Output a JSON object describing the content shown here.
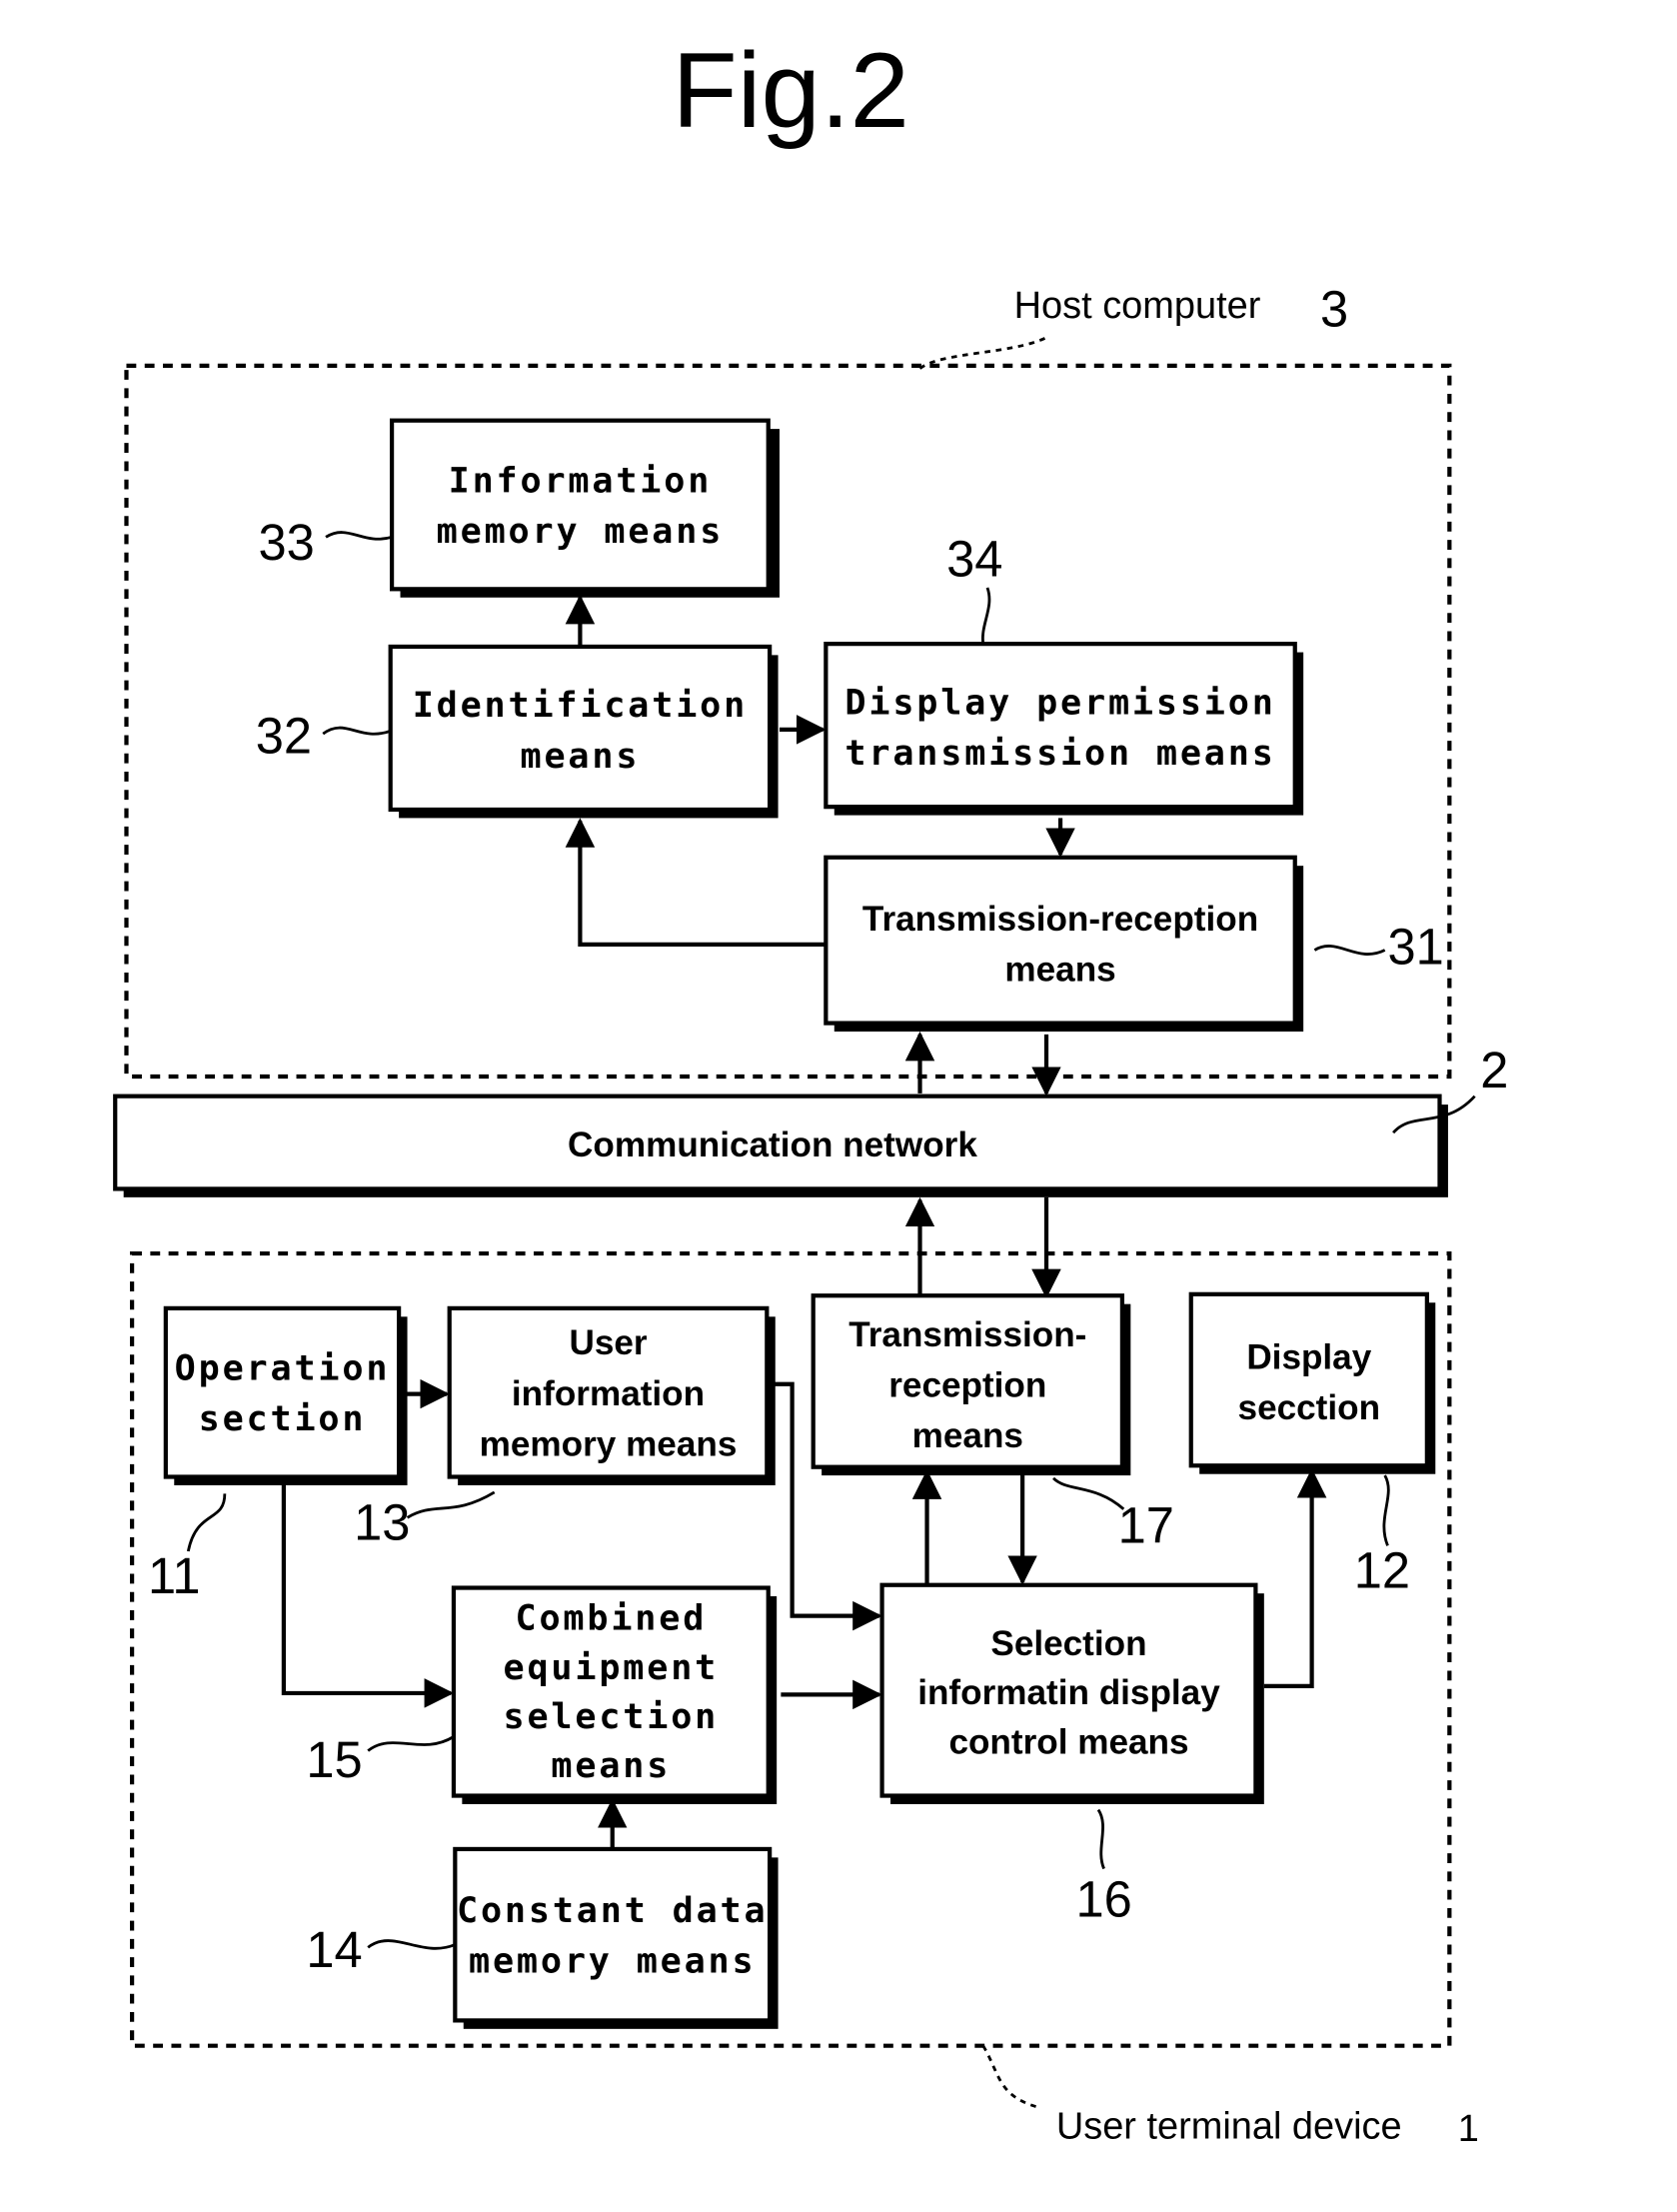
{
  "figure": {
    "title": "Fig.2",
    "host_computer": {
      "label": "Host computer",
      "ref": "3"
    },
    "user_terminal": {
      "label": "User terminal device",
      "ref": "1"
    },
    "network": {
      "label": "Communication network",
      "ref": "2"
    },
    "blocks": {
      "b33": {
        "ref": "33",
        "lines": [
          "Information",
          "memory means"
        ]
      },
      "b32": {
        "ref": "32",
        "lines": [
          "Identification",
          "means"
        ]
      },
      "b34": {
        "ref": "34",
        "lines": [
          "Display permission",
          "transmission means"
        ]
      },
      "b31": {
        "ref": "31",
        "lines": [
          "Transmission-reception",
          "means"
        ]
      },
      "b11": {
        "ref": "11",
        "lines": [
          "Operation",
          "section"
        ]
      },
      "b13": {
        "ref": "13",
        "lines": [
          "User",
          "information",
          "memory means"
        ]
      },
      "b17": {
        "ref": "17",
        "lines": [
          "Transmission-",
          "reception",
          "means"
        ]
      },
      "b12": {
        "ref": "12",
        "lines": [
          "Display",
          "secction"
        ]
      },
      "b15": {
        "ref": "15",
        "lines": [
          "Combined",
          "equipment",
          "selection",
          "means"
        ]
      },
      "b16": {
        "ref": "16",
        "lines": [
          "Selection",
          "informatin display",
          "control means"
        ]
      },
      "b14": {
        "ref": "14",
        "lines": [
          "Constant data",
          "memory means"
        ]
      }
    }
  }
}
